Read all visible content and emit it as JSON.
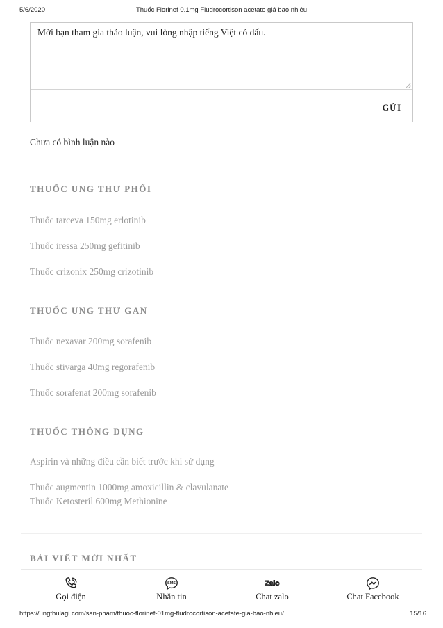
{
  "header": {
    "date": "5/6/2020",
    "title": "Thuốc Florinef 0.1mg Fludrocortison acetate giá bao nhiêu"
  },
  "comment_form": {
    "placeholder": "Mời bạn tham gia thảo luận, vui lòng nhập tiếng Việt có dấu.",
    "submit_label": "GỬI"
  },
  "no_comments": "Chưa có bình luận nào",
  "sections": [
    {
      "heading": "THUỐC UNG THƯ PHỔI",
      "links": [
        "Thuốc tarceva 150mg erlotinib",
        "Thuốc iressa 250mg gefitinib",
        "Thuốc crizonix 250mg crizotinib"
      ]
    },
    {
      "heading": "THUỐC UNG THƯ GAN",
      "links": [
        "Thuốc nexavar 200mg sorafenib",
        "Thuốc stivarga 40mg regorafenib",
        "Thuốc sorafenat 200mg sorafenib"
      ]
    },
    {
      "heading": "THUỐC THÔNG DỤNG",
      "links": [
        "Aspirin và những điều cần biết trước khi sử dụng",
        "Thuốc augmentin 1000mg amoxicillin & clavulanate",
        "Thuốc Ketosteril 600mg Methionine"
      ]
    },
    {
      "heading": "BÀI VIẾT MỚI NHẤT",
      "links": []
    }
  ],
  "bottom_bar": {
    "items": [
      {
        "label": "Gọi điện",
        "icon": "phone-icon"
      },
      {
        "label": "Nhắn tin",
        "icon": "sms-icon",
        "icon_text": "SMS"
      },
      {
        "label": "Chat zalo",
        "icon": "zalo-icon",
        "icon_text": "Zalo"
      },
      {
        "label": "Chat Facebook",
        "icon": "messenger-icon"
      }
    ]
  },
  "footer": {
    "url": "https://ungthulagi.com/san-pham/thuoc-florinef-01mg-fludrocortison-acetate-gia-bao-nhieu/",
    "pages": "15/16"
  },
  "colors": {
    "heading": "#8a8a8a",
    "link": "#999999",
    "text": "#222222",
    "border": "#c9c9c9"
  }
}
